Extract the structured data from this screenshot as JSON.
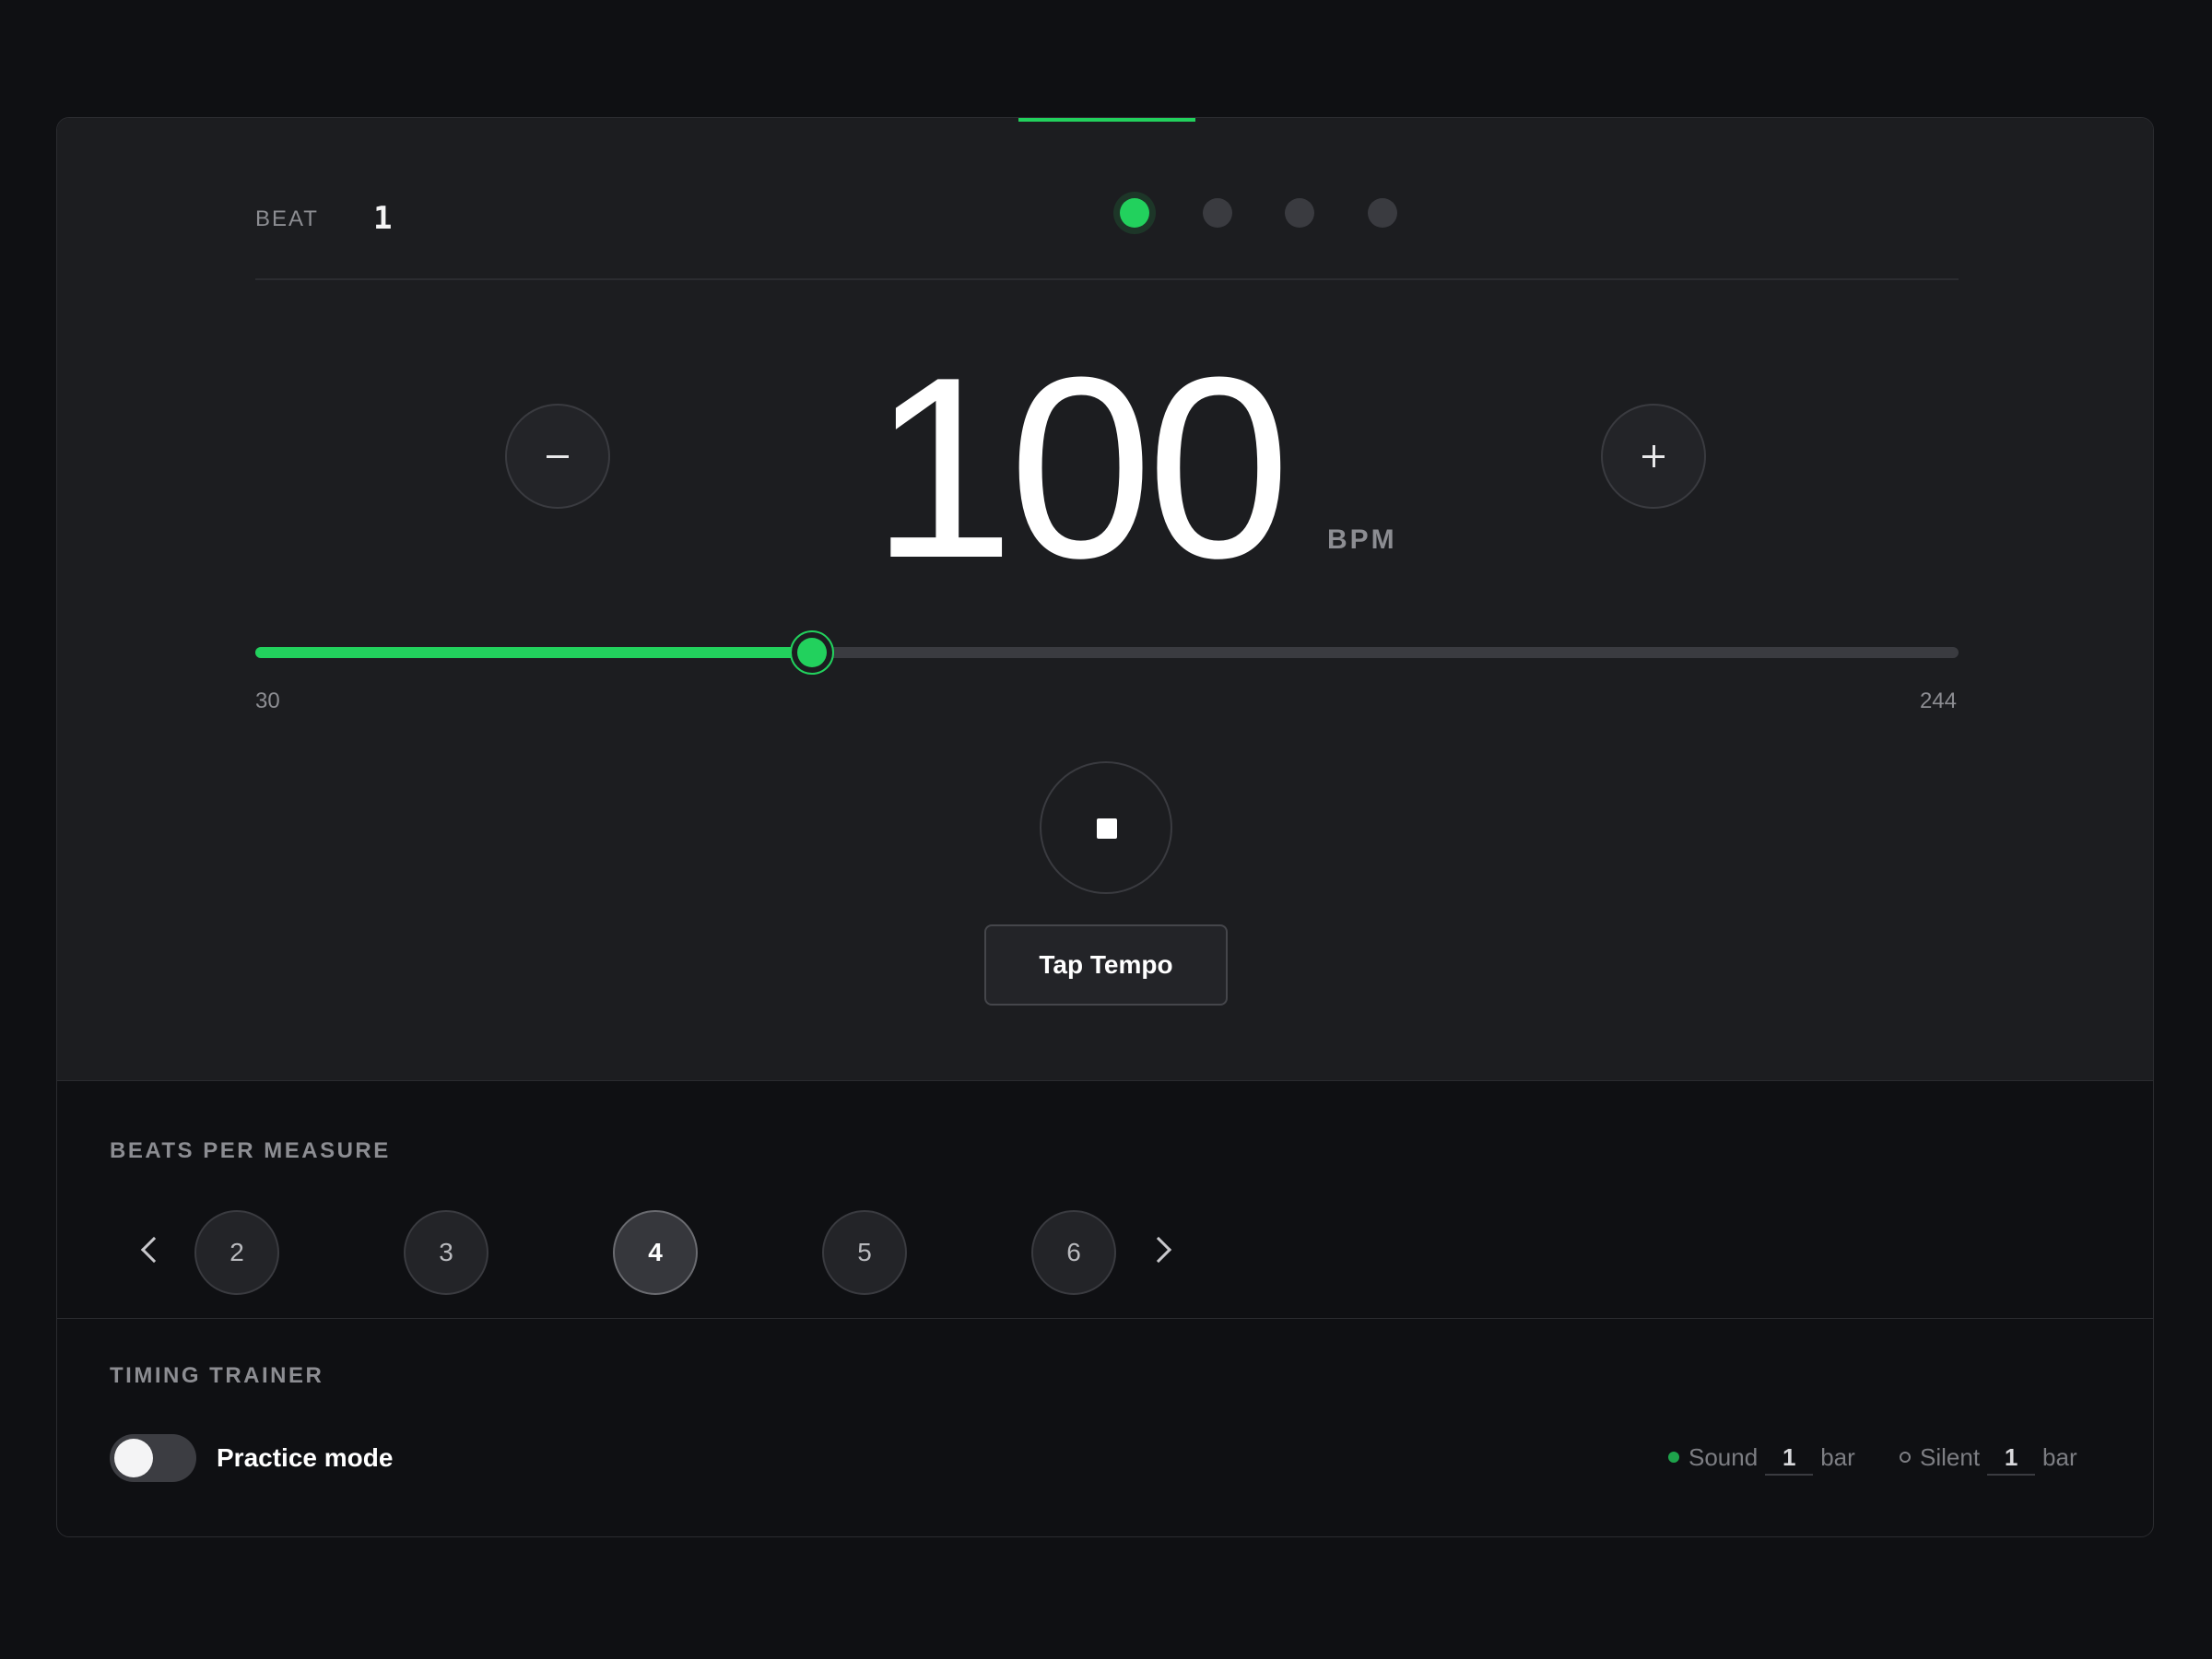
{
  "beat": {
    "label": "BEAT",
    "current": "1",
    "count": 4,
    "active_index": 0
  },
  "tempo": {
    "value": "100",
    "unit": "BPM",
    "min": "30",
    "max": "244",
    "decrement_icon": "minus-icon",
    "increment_icon": "plus-icon"
  },
  "transport": {
    "state": "playing",
    "play_button_icon": "stop-icon",
    "tap_tempo_label": "Tap Tempo"
  },
  "measure": {
    "title": "BEATS PER MEASURE",
    "options": [
      "2",
      "3",
      "4",
      "5",
      "6"
    ],
    "selected": "4",
    "prev_icon": "chevron-left-icon",
    "next_icon": "chevron-right-icon"
  },
  "trainer": {
    "title": "TIMING TRAINER",
    "practice_mode_label": "Practice mode",
    "practice_mode_on": false,
    "sound_label": "Sound",
    "sound_bars": "1",
    "silent_label": "Silent",
    "silent_bars": "1",
    "bar_unit": "bar"
  },
  "colors": {
    "accent": "#22d15d",
    "background": "#0f1013",
    "surface": "#1c1d20",
    "muted_text": "#8c8d92"
  }
}
